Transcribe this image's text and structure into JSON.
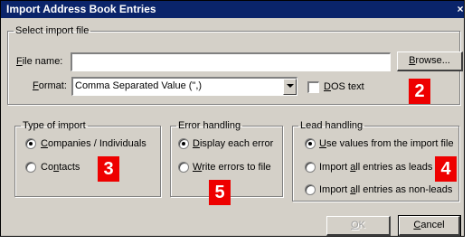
{
  "window": {
    "title": "Import Address Book Entries",
    "close_glyph": "×"
  },
  "select_file": {
    "legend": "Select import file",
    "file_name_label": {
      "mnemonic": "F",
      "rest": "ile name:"
    },
    "file_name_value": "",
    "browse_label": {
      "mnemonic": "B",
      "rest": "rowse..."
    },
    "format_label": {
      "mnemonic": "F",
      "rest": "ormat:"
    },
    "format_value": "Comma Separated Value (\",)",
    "dos_text_label": {
      "mnemonic": "D",
      "rest": "OS text"
    },
    "dos_text_checked": false
  },
  "type_of_import": {
    "legend": "Type of import",
    "options": [
      {
        "mnemonic": "C",
        "rest": "ompanies / Individuals",
        "selected": true
      },
      {
        "pre": "Co",
        "mnemonic": "n",
        "rest": "tacts",
        "selected": false
      }
    ]
  },
  "error_handling": {
    "legend": "Error handling",
    "options": [
      {
        "mnemonic": "D",
        "rest": "isplay each error",
        "selected": true
      },
      {
        "mnemonic": "W",
        "rest": "rite errors to file",
        "selected": false
      }
    ]
  },
  "lead_handling": {
    "legend": "Lead handling",
    "options": [
      {
        "mnemonic": "U",
        "rest": "se values from the import file",
        "selected": true
      },
      {
        "pre": "Import ",
        "mnemonic": "a",
        "rest": "ll entries as leads",
        "selected": false
      },
      {
        "pre": "Import ",
        "mnemonic": "a",
        "rest": "ll entries as non-leads",
        "selected": false
      }
    ]
  },
  "buttons": {
    "ok": {
      "mnemonic": "O",
      "rest": "K",
      "disabled": true
    },
    "cancel": {
      "mnemonic": "C",
      "rest": "ancel"
    }
  },
  "callouts": [
    "2",
    "3",
    "4",
    "5"
  ],
  "colors": {
    "title_bar": "#0a246a",
    "dialog_bg": "#d4d0c8",
    "callout": "#ee0000"
  },
  "icons": {
    "close": "close-icon",
    "dropdown": "chevron-down-icon"
  }
}
